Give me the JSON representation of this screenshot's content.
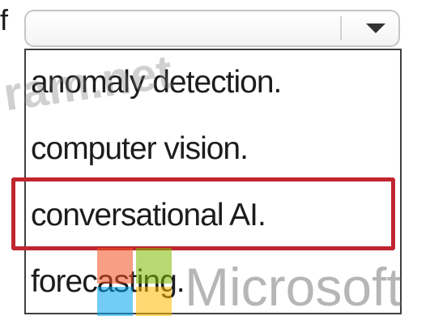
{
  "prompt": {
    "fragment": "f"
  },
  "dropdown": {
    "selected_value": "",
    "options": [
      {
        "label": "anomaly detection."
      },
      {
        "label": "computer vision."
      },
      {
        "label": "conversational AI."
      },
      {
        "label": "forecasting."
      }
    ]
  },
  "highlight": {
    "option_label": "conversational AI.",
    "color": "#c0262f"
  },
  "watermarks": {
    "site": "ram.net",
    "brand": "Microsoft"
  },
  "colors": {
    "logo_red": "#f25022",
    "logo_green": "#7fba00",
    "logo_blue": "#00a4ef",
    "logo_yellow": "#ffb900"
  }
}
